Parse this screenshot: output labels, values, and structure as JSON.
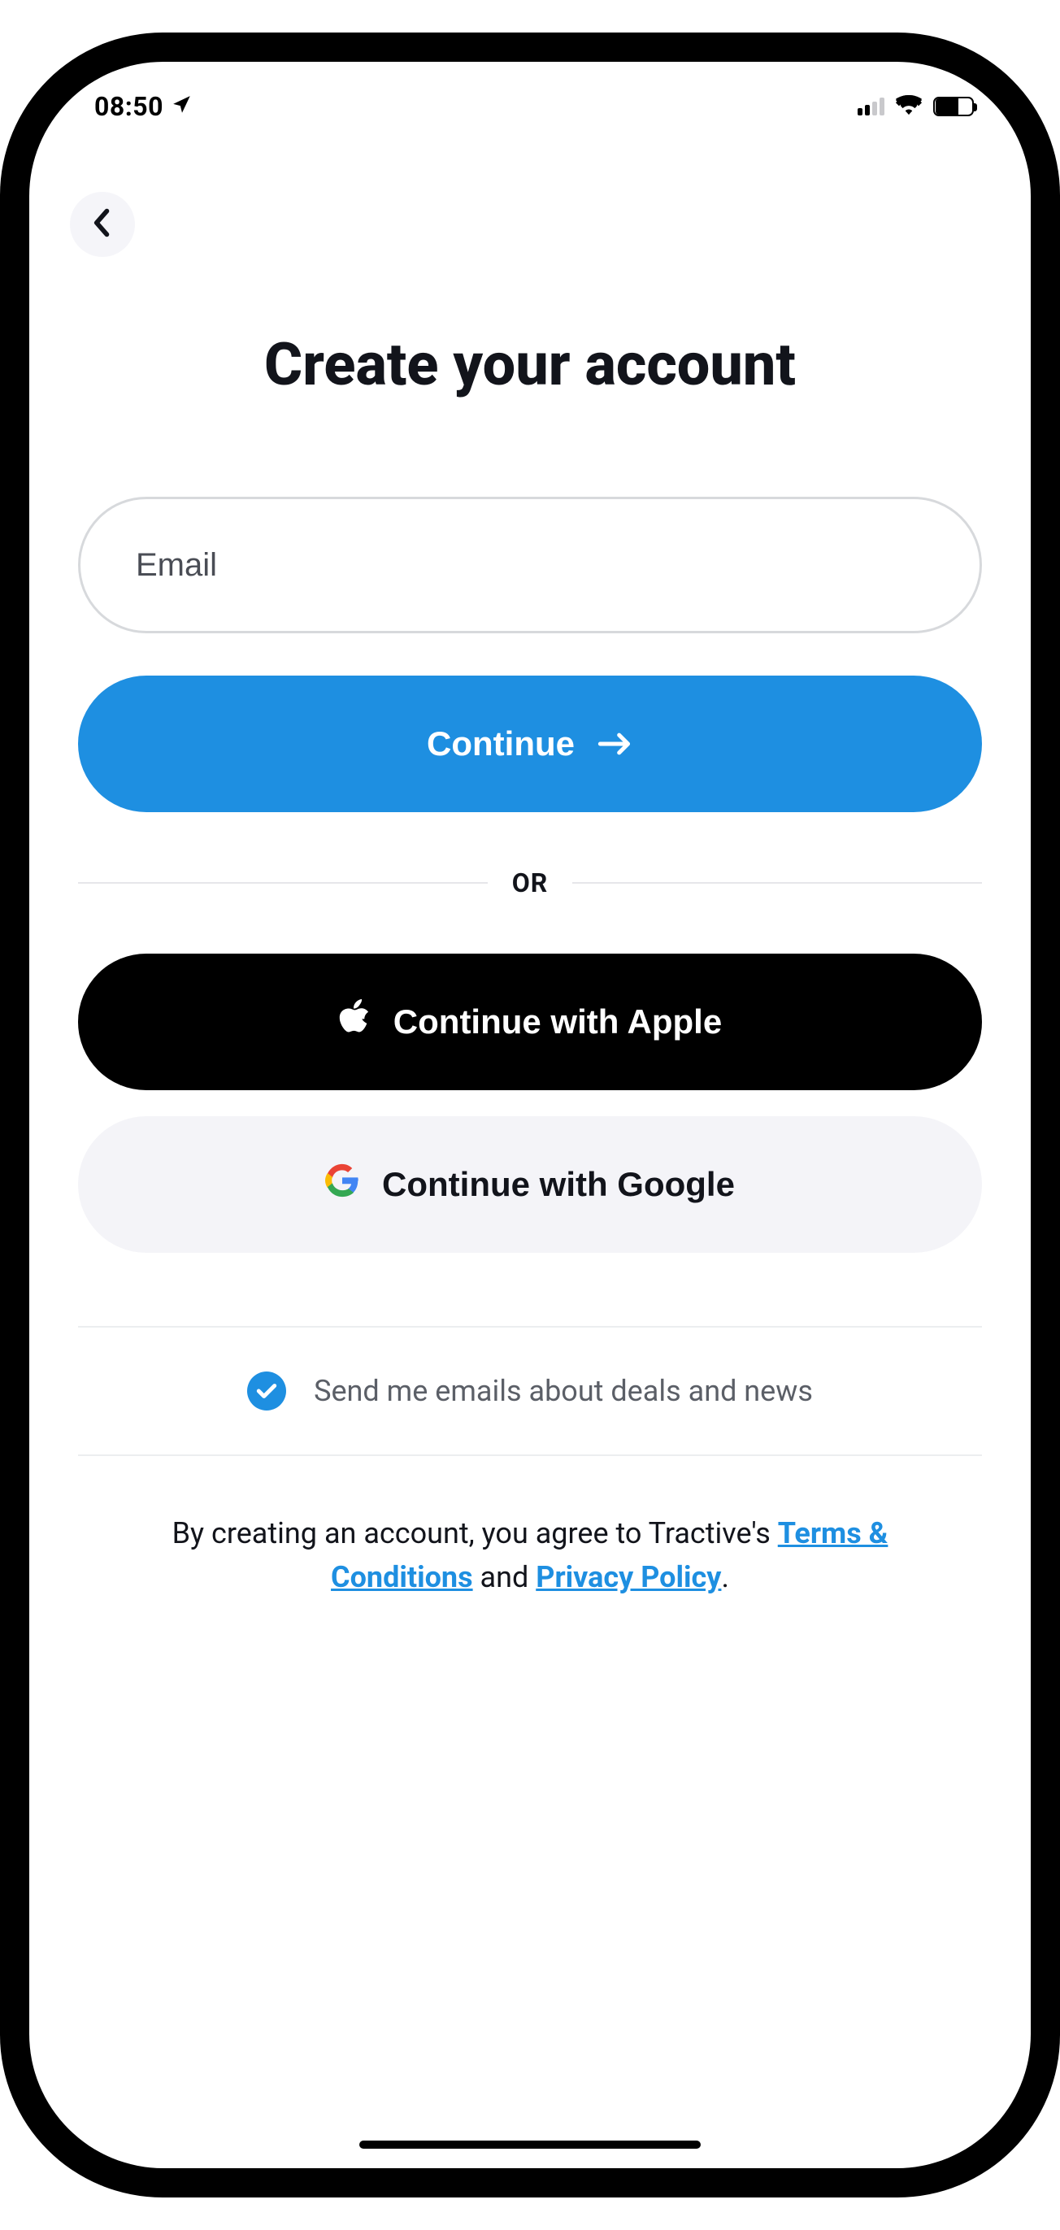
{
  "status": {
    "time": "08:50"
  },
  "page": {
    "title": "Create your account"
  },
  "form": {
    "email_placeholder": "Email",
    "continue_label": "Continue",
    "divider_label": "OR",
    "apple_label": "Continue with Apple",
    "google_label": "Continue with Google"
  },
  "consent": {
    "checked": true,
    "label": "Send me emails about deals and news"
  },
  "legal": {
    "prefix": "By creating an account, you agree to Tractive's ",
    "terms": "Terms & Conditions",
    "connector": " and ",
    "privacy": "Privacy Policy",
    "suffix": "."
  }
}
